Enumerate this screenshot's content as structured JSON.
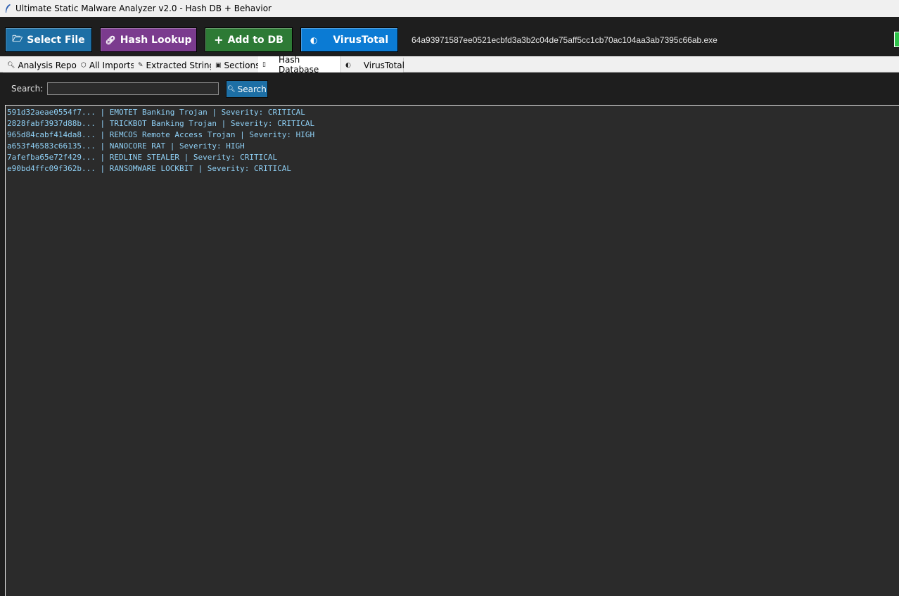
{
  "window": {
    "title": "Ultimate Static Malware Analyzer v2.0 - Hash DB + Behavior",
    "app_icon": "feather-icon"
  },
  "toolbar": {
    "select_file_label": "Select File",
    "hash_lookup_label": "Hash Lookup",
    "add_to_db_label": "Add to DB",
    "virustotal_label": "VirusTotal",
    "select_file_icon": "folder-icon",
    "hash_lookup_icon": "link-icon",
    "add_to_db_icon": "plus-icon",
    "virustotal_icon": "shield-icon",
    "filename": "64a93971587ee0521ecbfd3a3b2c04de75aff5cc1cb70ac104aa3ab7395c66ab.exe"
  },
  "tabs": [
    {
      "label": "Analysis Report",
      "icon": "magnifier-icon"
    },
    {
      "label": "All Imports",
      "icon": "package-icon"
    },
    {
      "label": "Extracted Strings",
      "icon": "string-icon"
    },
    {
      "label": "Sections",
      "icon": "disk-icon"
    },
    {
      "label": "Hash Database",
      "icon": "clipboard-icon",
      "active": true
    },
    {
      "label": "VirusTotal",
      "icon": "shield-icon"
    }
  ],
  "search": {
    "label": "Search:",
    "value": "",
    "button_label": "Search"
  },
  "results": [
    {
      "hash": "591d32aeae0554f7...",
      "name": "EMOTET Banking Trojan",
      "severity": "CRITICAL",
      "line": "591d32aeae0554f7... | EMOTET Banking Trojan | Severity: CRITICAL"
    },
    {
      "hash": "2828fabf3937d88b...",
      "name": "TRICKBOT Banking Trojan",
      "severity": "CRITICAL",
      "line": "2828fabf3937d88b... | TRICKBOT Banking Trojan | Severity: CRITICAL"
    },
    {
      "hash": "965d84cabf414da8...",
      "name": "REMCOS Remote Access Trojan",
      "severity": "HIGH",
      "line": "965d84cabf414da8... | REMCOS Remote Access Trojan | Severity: HIGH"
    },
    {
      "hash": "a653f46583c66135...",
      "name": "NANOCORE RAT",
      "severity": "HIGH",
      "line": "a653f46583c66135... | NANOCORE RAT | Severity: HIGH"
    },
    {
      "hash": "7afefba65e72f429...",
      "name": "REDLINE STEALER",
      "severity": "CRITICAL",
      "line": "7afefba65e72f429... | REDLINE STEALER | Severity: CRITICAL"
    },
    {
      "hash": "e90bd4ffc09f362b...",
      "name": "RANSOMWARE LOCKBIT",
      "severity": "CRITICAL",
      "line": "e90bd4ffc09f362b... | RANSOMWARE LOCKBIT | Severity: CRITICAL"
    }
  ],
  "colors": {
    "select_file": "#1d6fa5",
    "hash_lookup": "#7b3b8e",
    "add_to_db": "#2d7a35",
    "virustotal": "#0b7bd4",
    "result_text": "#8fd0f5",
    "status_indicator": "#2ec24a"
  }
}
